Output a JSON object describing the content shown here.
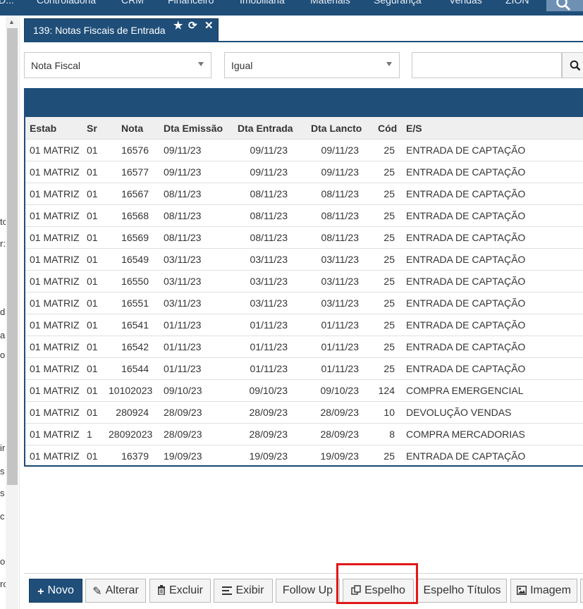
{
  "top_menu": {
    "items": [
      "D...",
      "Controladoria",
      "CRM",
      "Financeiro",
      "Imobiliária",
      "Materiais",
      "Segurança",
      "Vendas",
      "ZION"
    ]
  },
  "left_fragments": [
    "tc",
    "r:",
    "da",
    "a",
    "o",
    "ir",
    "s",
    "s",
    "c",
    "ol",
    "rc"
  ],
  "tab": {
    "title": "139: Notas Fiscais de Entrada",
    "star_icon": "★",
    "refresh_icon": "⟳",
    "close_icon": "✕"
  },
  "filter": {
    "field": "Nota Fiscal",
    "operator": "Igual",
    "value": ""
  },
  "grid": {
    "columns": [
      "Estab",
      "Sr",
      "Nota",
      "Dta Emissão",
      "Dta Entrada",
      "Dta Lancto",
      "Cód",
      "E/S"
    ],
    "rows": [
      {
        "estab": "01 MATRIZ",
        "sr": "01",
        "nota": "16576",
        "emissao": "09/11/23",
        "entrada": "09/11/23",
        "lancto": "09/11/23",
        "cod": "25",
        "es": "ENTRADA DE CAPTAÇÃO"
      },
      {
        "estab": "01 MATRIZ",
        "sr": "01",
        "nota": "16577",
        "emissao": "09/11/23",
        "entrada": "09/11/23",
        "lancto": "09/11/23",
        "cod": "25",
        "es": "ENTRADA DE CAPTAÇÃO"
      },
      {
        "estab": "01 MATRIZ",
        "sr": "01",
        "nota": "16567",
        "emissao": "08/11/23",
        "entrada": "08/11/23",
        "lancto": "08/11/23",
        "cod": "25",
        "es": "ENTRADA DE CAPTAÇÃO"
      },
      {
        "estab": "01 MATRIZ",
        "sr": "01",
        "nota": "16568",
        "emissao": "08/11/23",
        "entrada": "08/11/23",
        "lancto": "08/11/23",
        "cod": "25",
        "es": "ENTRADA DE CAPTAÇÃO"
      },
      {
        "estab": "01 MATRIZ",
        "sr": "01",
        "nota": "16569",
        "emissao": "08/11/23",
        "entrada": "08/11/23",
        "lancto": "08/11/23",
        "cod": "25",
        "es": "ENTRADA DE CAPTAÇÃO"
      },
      {
        "estab": "01 MATRIZ",
        "sr": "01",
        "nota": "16549",
        "emissao": "03/11/23",
        "entrada": "03/11/23",
        "lancto": "03/11/23",
        "cod": "25",
        "es": "ENTRADA DE CAPTAÇÃO"
      },
      {
        "estab": "01 MATRIZ",
        "sr": "01",
        "nota": "16550",
        "emissao": "03/11/23",
        "entrada": "03/11/23",
        "lancto": "03/11/23",
        "cod": "25",
        "es": "ENTRADA DE CAPTAÇÃO"
      },
      {
        "estab": "01 MATRIZ",
        "sr": "01",
        "nota": "16551",
        "emissao": "03/11/23",
        "entrada": "03/11/23",
        "lancto": "03/11/23",
        "cod": "25",
        "es": "ENTRADA DE CAPTAÇÃO"
      },
      {
        "estab": "01 MATRIZ",
        "sr": "01",
        "nota": "16541",
        "emissao": "01/11/23",
        "entrada": "01/11/23",
        "lancto": "01/11/23",
        "cod": "25",
        "es": "ENTRADA DE CAPTAÇÃO"
      },
      {
        "estab": "01 MATRIZ",
        "sr": "01",
        "nota": "16542",
        "emissao": "01/11/23",
        "entrada": "01/11/23",
        "lancto": "01/11/23",
        "cod": "25",
        "es": "ENTRADA DE CAPTAÇÃO"
      },
      {
        "estab": "01 MATRIZ",
        "sr": "01",
        "nota": "16544",
        "emissao": "01/11/23",
        "entrada": "01/11/23",
        "lancto": "01/11/23",
        "cod": "25",
        "es": "ENTRADA DE CAPTAÇÃO"
      },
      {
        "estab": "01 MATRIZ",
        "sr": "01",
        "nota": "10102023",
        "emissao": "09/10/23",
        "entrada": "09/10/23",
        "lancto": "09/10/23",
        "cod": "124",
        "es": "COMPRA EMERGENCIAL"
      },
      {
        "estab": "01 MATRIZ",
        "sr": "01",
        "nota": "280924",
        "emissao": "28/09/23",
        "entrada": "28/09/23",
        "lancto": "28/09/23",
        "cod": "10",
        "es": "DEVOLUÇÃO VENDAS"
      },
      {
        "estab": "01 MATRIZ",
        "sr": "1",
        "nota": "28092023",
        "emissao": "28/09/23",
        "entrada": "28/09/23",
        "lancto": "28/09/23",
        "cod": "8",
        "es": "COMPRA MERCADORIAS"
      },
      {
        "estab": "01 MATRIZ",
        "sr": "01",
        "nota": "16379",
        "emissao": "19/09/23",
        "entrada": "19/09/23",
        "lancto": "19/09/23",
        "cod": "25",
        "es": "ENTRADA DE CAPTAÇÃO"
      }
    ]
  },
  "toolbar": {
    "novo": "Novo",
    "alterar": "Alterar",
    "excluir": "Excluir",
    "exibir": "Exibir",
    "follow_up": "Follow Up",
    "espelho": "Espelho",
    "espelho_titulos": "Espelho Títulos",
    "imagem": "Imagem"
  },
  "colors": {
    "primary": "#1f4e79",
    "highlight": "#e01818"
  }
}
